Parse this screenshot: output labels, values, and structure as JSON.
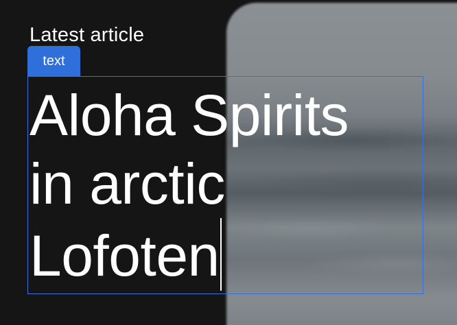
{
  "eyebrow": "Latest article",
  "selection": {
    "tag_label": "text",
    "accent_color": "#2f6fdc"
  },
  "headline": {
    "lines": [
      "Aloha Spirits",
      "in arctic",
      "Lofoten"
    ]
  },
  "hero_image": {
    "description_icon": "photo-icon"
  },
  "colors": {
    "background": "#151515",
    "text": "#ffffff"
  }
}
